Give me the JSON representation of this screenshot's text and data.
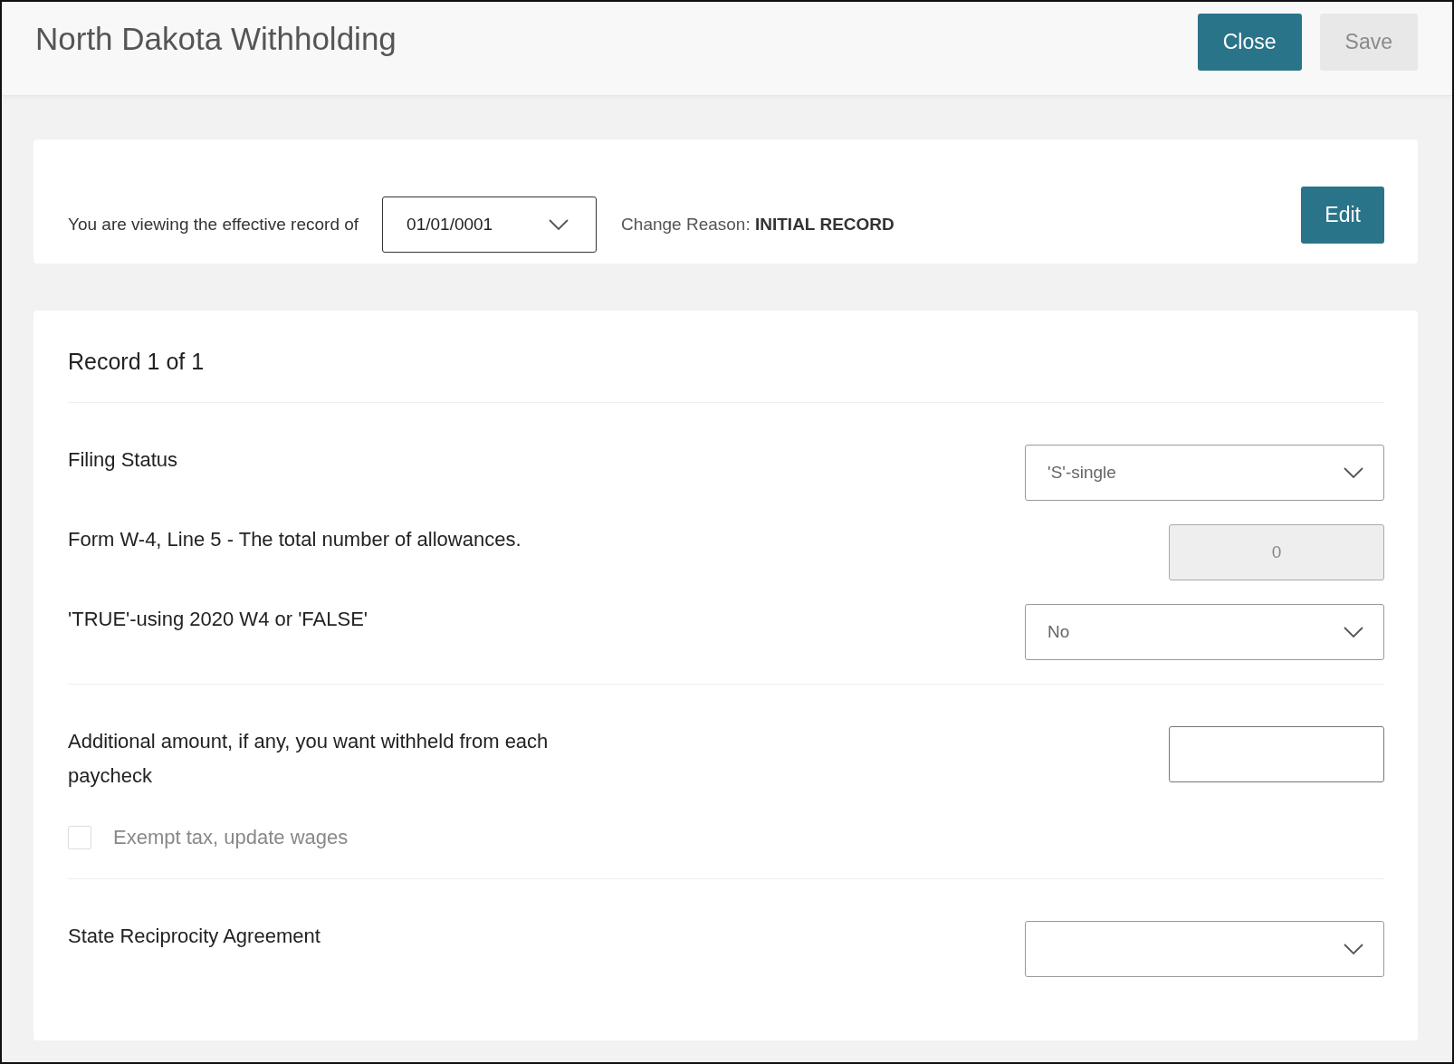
{
  "header": {
    "title": "North Dakota Withholding",
    "buttons": [
      {
        "label": "Close",
        "disabled": false
      },
      {
        "label": "Save",
        "disabled": true
      }
    ]
  },
  "effective": {
    "label": "You are viewing the effective record of",
    "date": "01/01/0001",
    "change_reason_label": "Change Reason:",
    "change_reason": "INITIAL RECORD",
    "edit_button": "Edit"
  },
  "record": {
    "title": "Record 1 of 1",
    "sections": [
      {
        "fields": [
          {
            "kind": "select",
            "label": "Filing Status",
            "value": "'S'-single"
          },
          {
            "kind": "number",
            "label": "Form W-4, Line 5 - The total number of allowances.",
            "value": "0",
            "disabled": true
          },
          {
            "kind": "select",
            "label": "'TRUE'-using 2020 W4 or 'FALSE'",
            "value": "No"
          }
        ]
      },
      {
        "fields": [
          {
            "kind": "number",
            "label": "Additional amount, if any, you want withheld from each paycheck",
            "disabled": false
          },
          {
            "kind": "checkbox",
            "label": "Exempt tax, update wages",
            "checked": false,
            "disabled": true
          }
        ]
      },
      {
        "fields": [
          {
            "kind": "select",
            "label": "State Reciprocity Agreement"
          }
        ]
      }
    ]
  }
}
